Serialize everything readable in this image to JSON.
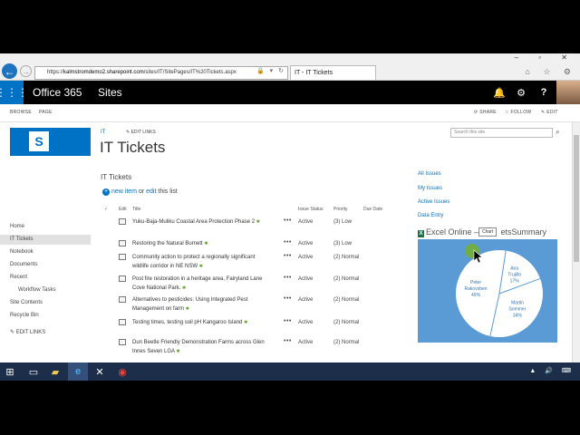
{
  "browser": {
    "address_url_prefix": "https://",
    "address_url_host": "kalmstromdemo2.sharepoint.com",
    "address_url_rest": "/sites/IT/SitePages/IT%20Tickets.aspx",
    "address_icons": "🔒 ▾ ↻",
    "tab_label": "IT - IT Tickets",
    "window_controls": "– ▫ ✕",
    "tools": "⌂ ☆ ⚙"
  },
  "suite": {
    "brand": "Office 365",
    "section": "Sites"
  },
  "ribbon": {
    "browse": "BROWSE",
    "page": "PAGE",
    "share": "SHARE",
    "follow": "FOLLOW",
    "edit": "EDIT"
  },
  "header": {
    "breadcrumb": "IT",
    "edit_links": "EDIT LINKS",
    "title": "IT Tickets",
    "search_placeholder": "Search this site"
  },
  "leftnav": {
    "items": [
      "Home",
      "IT Tickets",
      "Notebook",
      "Documents",
      "Recent",
      "Workflow Tasks",
      "Site Contents",
      "Recycle Bin"
    ],
    "edit_links": "EDIT LINKS"
  },
  "list": {
    "title": "IT Tickets",
    "new_item": "new item",
    "or": " or ",
    "edit": "edit",
    "this_list": " this list",
    "columns": [
      "Edit",
      "Title",
      "Issue Status",
      "Priority",
      "Due Date"
    ],
    "rows": [
      {
        "title": "Yuku-Baja-Muliku Coastal Area Protection Phase 2",
        "status": "Active",
        "priority": "(3) Low"
      },
      {
        "title": "Restoring the Natural Burnett",
        "status": "Active",
        "priority": "(3) Low"
      },
      {
        "title": "Community action to protect a regionally significant wildlife corridor in NE NSW",
        "status": "Active",
        "priority": "(2) Normal"
      },
      {
        "title": "Post fire restoration in a heritage area, Fairyland Lane Cove National Park.",
        "status": "Active",
        "priority": "(2) Normal"
      },
      {
        "title": "Alternatives to pesticides: Using Integrated Pest Management on farm",
        "status": "Active",
        "priority": "(2) Normal"
      },
      {
        "title": "Testing times, testing soil pH Kangaroo Island",
        "status": "Active",
        "priority": "(2) Normal"
      },
      {
        "title": "Dun Beetle Friendly Demonstration Farms across Glen Innes Seven LGA",
        "status": "Active",
        "priority": "(2) Normal"
      }
    ],
    "new_badge": "✱"
  },
  "right_links": [
    "All Issues",
    "My Issues",
    "Active Issues",
    "Data Entry"
  ],
  "excel": {
    "title_left": "Excel Online – ",
    "title_right": "etsSummary",
    "tooltip": "Chart",
    "icon_letter": "X"
  },
  "chart_data": {
    "type": "pie",
    "slices": [
      {
        "label": "Ana Trujillo",
        "value": 17,
        "display": "17%"
      },
      {
        "label": "Martin Sommer",
        "value": 34,
        "display": "34%"
      },
      {
        "label": "Peter Rakovsben",
        "value": 49,
        "display": "49%"
      }
    ]
  },
  "colors": {
    "brand_blue": "#0072c6",
    "chart_bg": "#5b9bd5",
    "suite_bg": "#000000",
    "taskbar_bg": "#1c2e4a"
  },
  "taskbar": {
    "tray": "▲ 🔊 ⌨"
  }
}
